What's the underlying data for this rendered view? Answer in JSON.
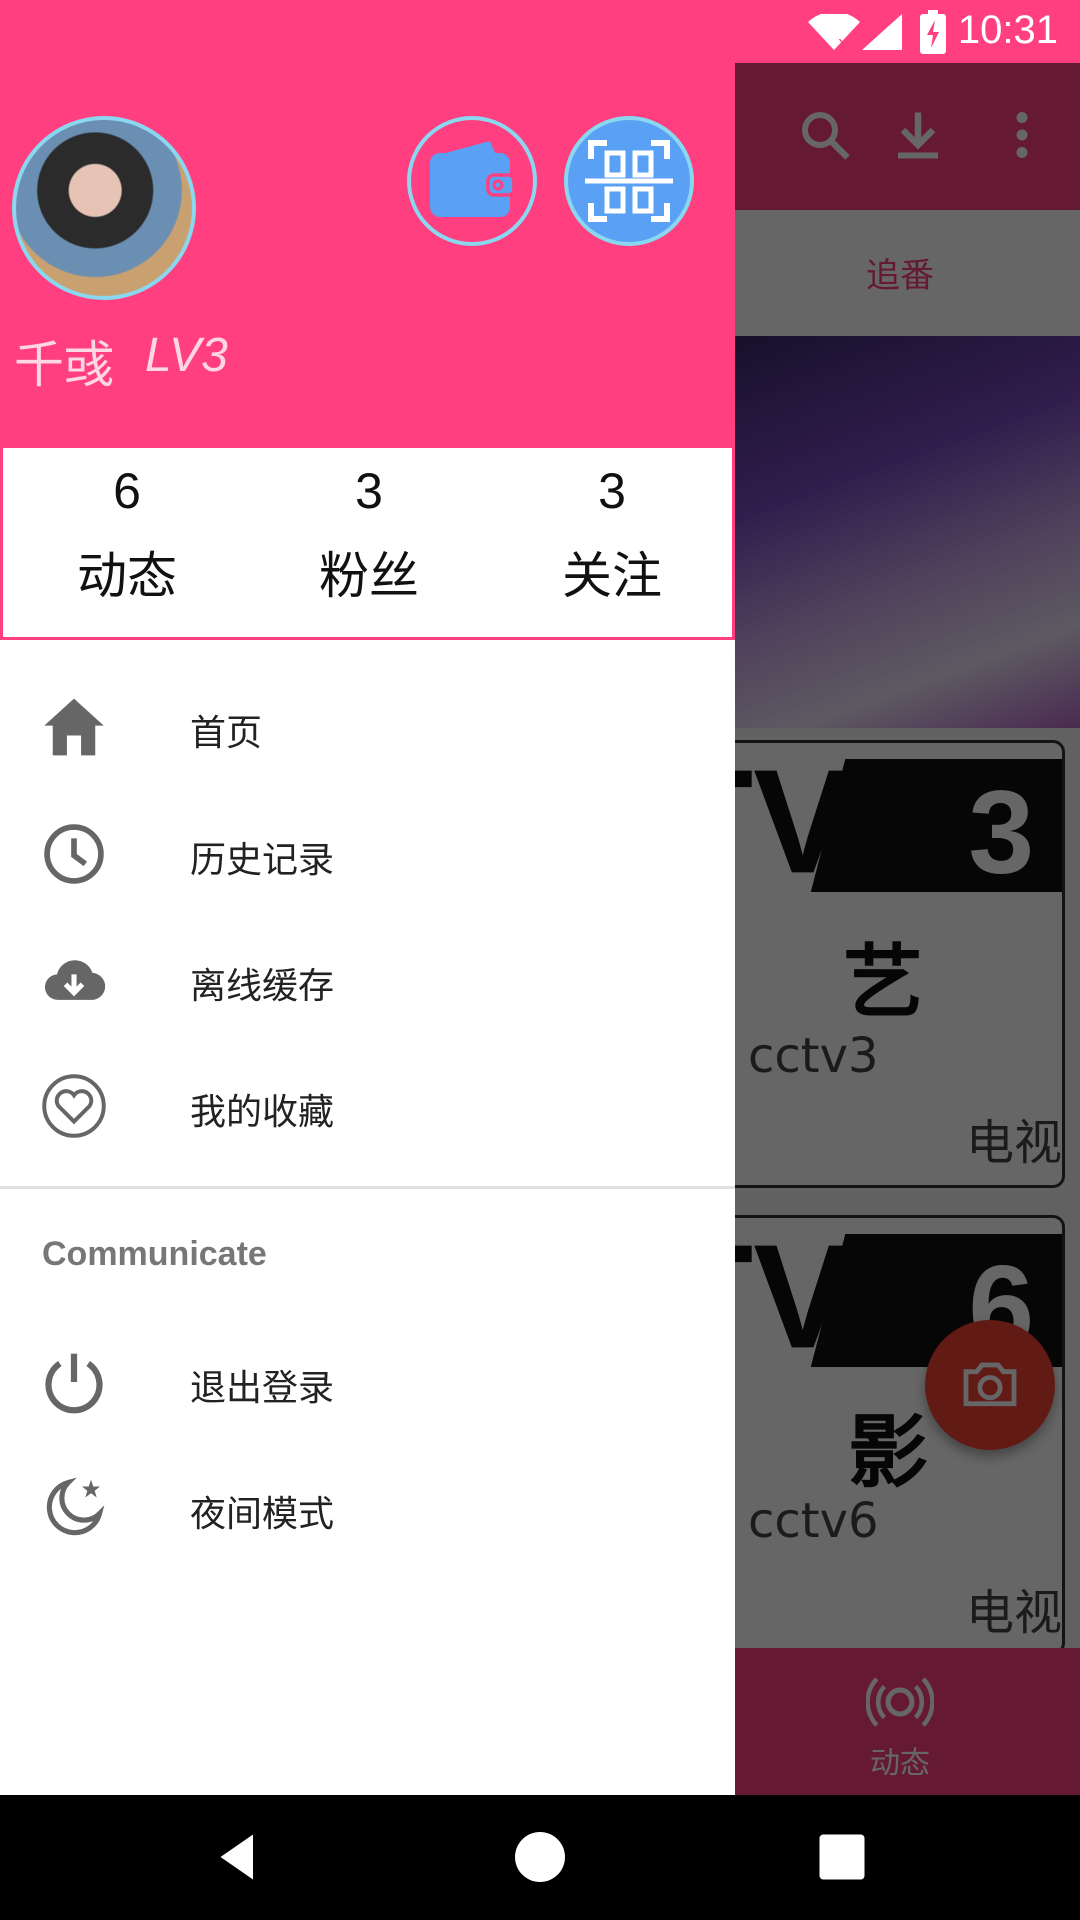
{
  "status_bar": {
    "time": "10:31"
  },
  "background": {
    "tab_label": "追番",
    "cards": [
      {
        "channel_name": "cctv3",
        "channel_type": "电视",
        "logo_number": "3",
        "cn_text": "艺"
      },
      {
        "channel_name": "cctv6",
        "channel_type": "电视",
        "logo_number": "6",
        "cn_text": "影"
      }
    ],
    "bottom_nav_label": "动态"
  },
  "drawer": {
    "user": {
      "name": "千彧",
      "level": "LV3"
    },
    "stats": [
      {
        "value": "6",
        "label": "动态"
      },
      {
        "value": "3",
        "label": "粉丝"
      },
      {
        "value": "3",
        "label": "关注"
      }
    ],
    "menu": [
      {
        "label": "首页",
        "icon": "home-icon"
      },
      {
        "label": "历史记录",
        "icon": "history-icon"
      },
      {
        "label": "离线缓存",
        "icon": "cloud-download-icon"
      },
      {
        "label": "我的收藏",
        "icon": "favorite-icon"
      }
    ],
    "section_title": "Communicate",
    "section_menu": [
      {
        "label": "退出登录",
        "icon": "power-icon"
      },
      {
        "label": "夜间模式",
        "icon": "night-mode-icon"
      }
    ]
  },
  "colors": {
    "accent": "#FF3F7F",
    "light_blue": "#5aa0f5",
    "scrim": "rgba(0,0,0,0.6)"
  }
}
